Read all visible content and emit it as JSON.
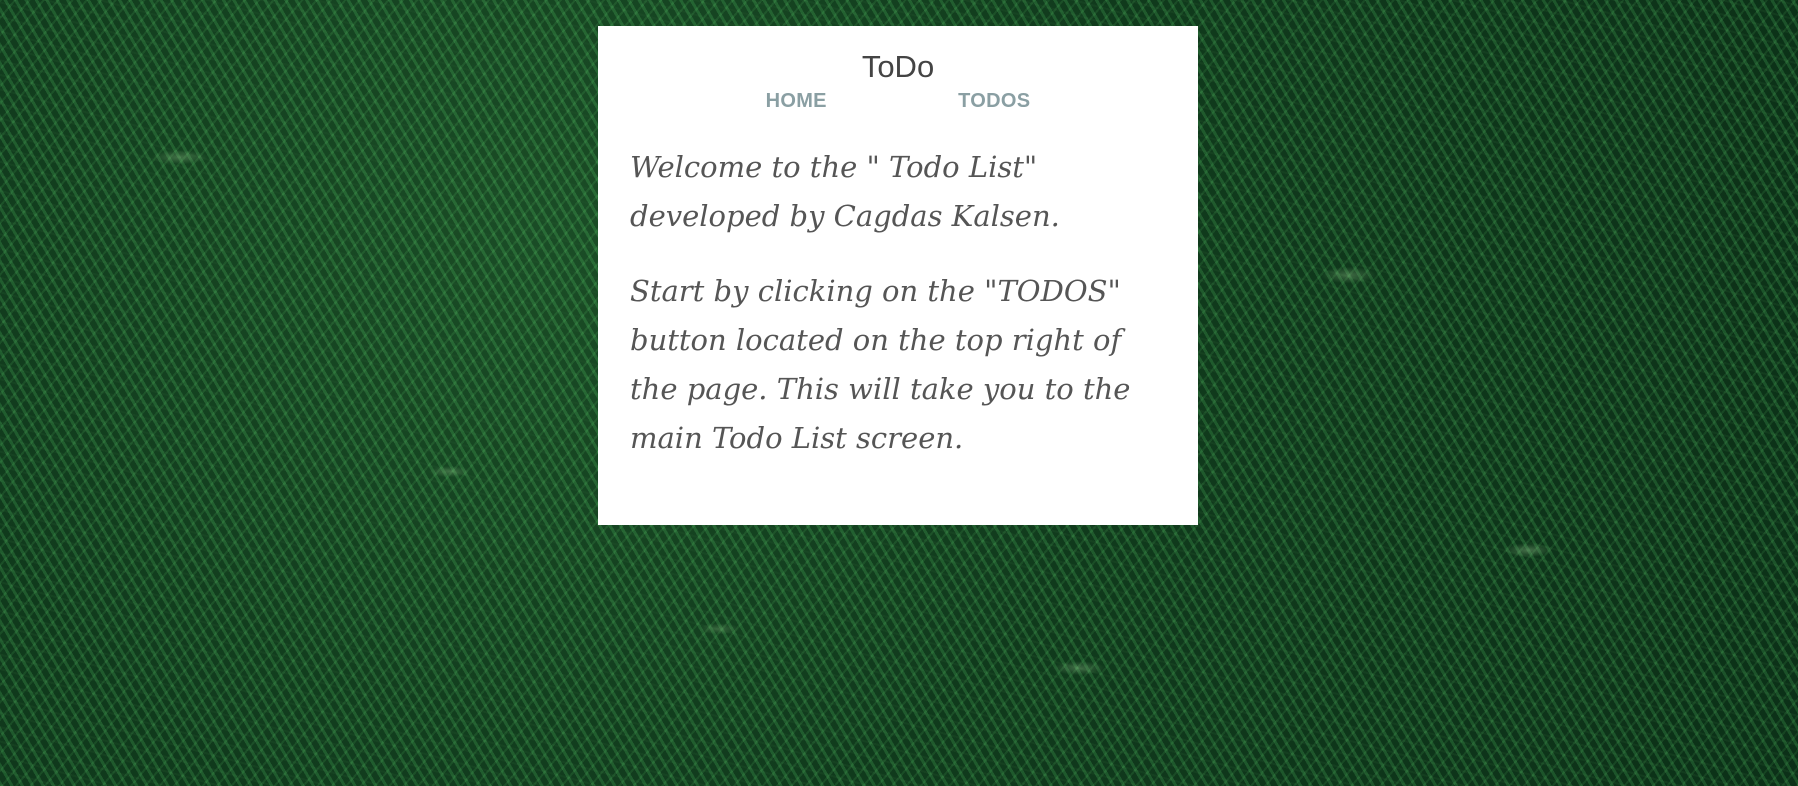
{
  "header": {
    "title": "ToDo"
  },
  "nav": {
    "items": [
      {
        "label": "HOME"
      },
      {
        "label": "TODOS"
      }
    ]
  },
  "content": {
    "welcome": "Welcome to the \" Todo List\" developed by Cagdas Kalsen.",
    "instructions": "Start by clicking on the \"TODOS\" button located on the top right of the page. This will take you to the main Todo List screen."
  },
  "colors": {
    "card_background": "#ffffff",
    "title_text": "#444444",
    "nav_link": "#8a9fa3",
    "body_text": "#555555",
    "background_green": "#1f5a2e"
  }
}
